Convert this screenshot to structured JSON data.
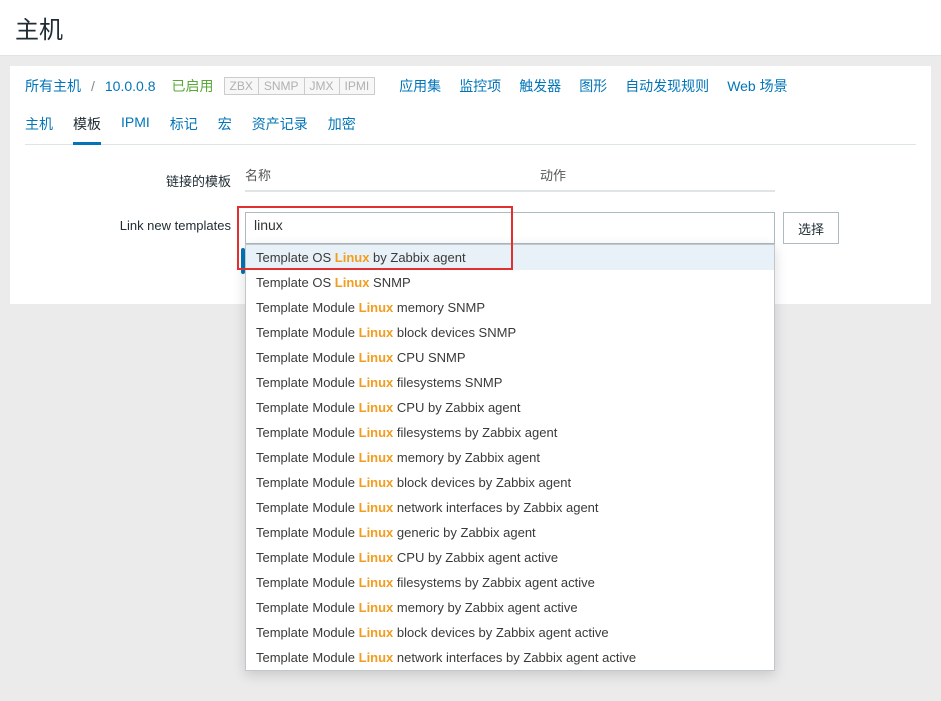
{
  "page": {
    "title": "主机"
  },
  "breadcrumb": {
    "all_hosts": "所有主机",
    "host": "10.0.0.8",
    "status": "已启用",
    "badges": [
      "ZBX",
      "SNMP",
      "JMX",
      "IPMI"
    ]
  },
  "top_links": [
    "应用集",
    "监控项",
    "触发器",
    "图形",
    "自动发现规则",
    "Web 场景"
  ],
  "tabs": [
    "主机",
    "模板",
    "IPMI",
    "标记",
    "宏",
    "资产记录",
    "加密"
  ],
  "active_tab_index": 1,
  "form": {
    "linked_templates_label": "链接的模板",
    "table_col_name": "名称",
    "table_col_action": "动作",
    "link_new_label": "Link new templates",
    "search_value": "linux",
    "select_button": "选择"
  },
  "dropdown": {
    "highlight": "Linux",
    "items": [
      {
        "pre": "Template OS ",
        "post": " by Zabbix agent",
        "hover": true
      },
      {
        "pre": "Template OS ",
        "post": " SNMP"
      },
      {
        "pre": "Template Module ",
        "post": " memory SNMP"
      },
      {
        "pre": "Template Module ",
        "post": " block devices SNMP"
      },
      {
        "pre": "Template Module ",
        "post": " CPU SNMP"
      },
      {
        "pre": "Template Module ",
        "post": " filesystems SNMP"
      },
      {
        "pre": "Template Module ",
        "post": " CPU by Zabbix agent"
      },
      {
        "pre": "Template Module ",
        "post": " filesystems by Zabbix agent"
      },
      {
        "pre": "Template Module ",
        "post": " memory by Zabbix agent"
      },
      {
        "pre": "Template Module ",
        "post": " block devices by Zabbix agent"
      },
      {
        "pre": "Template Module ",
        "post": " network interfaces by Zabbix agent"
      },
      {
        "pre": "Template Module ",
        "post": " generic by Zabbix agent"
      },
      {
        "pre": "Template Module ",
        "post": " CPU by Zabbix agent active"
      },
      {
        "pre": "Template Module ",
        "post": " filesystems by Zabbix agent active"
      },
      {
        "pre": "Template Module ",
        "post": " memory by Zabbix agent active"
      },
      {
        "pre": "Template Module ",
        "post": " block devices by Zabbix agent active"
      },
      {
        "pre": "Template Module ",
        "post": " network interfaces by Zabbix agent active"
      }
    ]
  }
}
